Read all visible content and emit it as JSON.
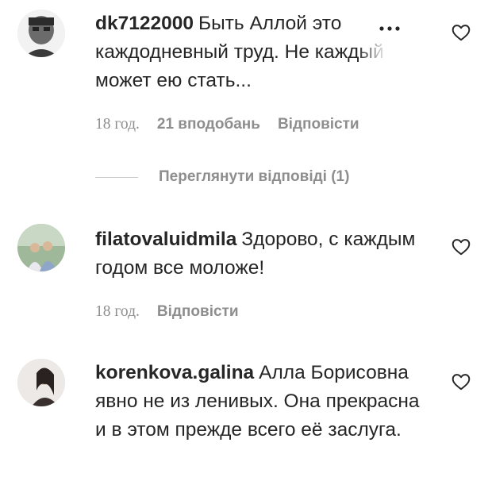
{
  "comments": [
    {
      "username": "dk7122000",
      "text_main": "Быть Аллой это каждодневный труд. Не ка",
      "text_faded": "ждый",
      "text_end": "может ею стать...",
      "time": "18 год.",
      "likes": "21 вподобань",
      "reply": "Відповісти",
      "more_icon": "more-dots-icon",
      "heart_icon": "heart-outline-icon"
    },
    {
      "username": "filatovaluidmila",
      "text": "Здорово, с каждым годом все моложе!",
      "time": "18 год.",
      "reply": "Відповісти",
      "heart_icon": "heart-outline-icon"
    },
    {
      "username": "korenkova.galina",
      "text": "Алла Борисовна явно не из ленивых. Она прекрасна и в этом прежде всего её заслуга.",
      "heart_icon": "heart-outline-icon"
    }
  ],
  "view_replies": "Переглянути відповіді (1)",
  "colors": {
    "text": "#262626",
    "secondary": "#8e8e8e",
    "divider": "#c7c7c7"
  }
}
